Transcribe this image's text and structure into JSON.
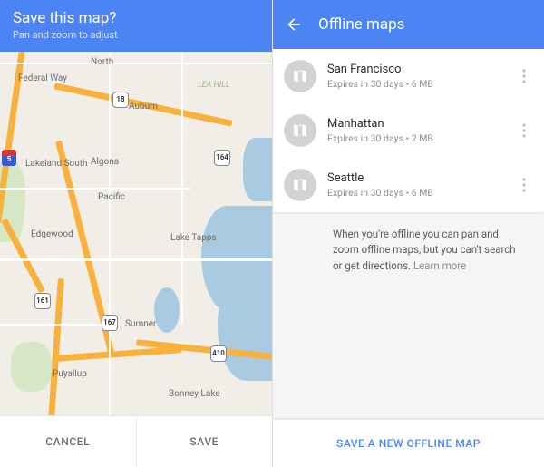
{
  "colors": {
    "primary": "#4c84f4",
    "accent": "#f7b13c",
    "water": "#a9cbe2"
  },
  "left": {
    "title": "Save this map?",
    "subtitle": "Pan and zoom to adjust",
    "cancel": "CANCEL",
    "save": "SAVE",
    "labels": {
      "federal": "Federal Way",
      "north": "North",
      "auburn": "Auburn",
      "leahill": "LEA HILL",
      "lakeland": "Lakeland South",
      "algona": "Algona",
      "pacific": "Pacific",
      "edgewood": "Edgewood",
      "laketapps": "Lake Tapps",
      "sumner": "Sumner",
      "puyallup": "Puyallup",
      "bonney": "Bonney Lake"
    },
    "shields": {
      "i5": "5",
      "r18": "18",
      "r164": "164",
      "r161": "161",
      "r167": "167",
      "r410": "410"
    }
  },
  "right": {
    "title": "Offline maps",
    "items": [
      {
        "name": "San Francisco",
        "meta": "Expires in 30 days  •  6 MB"
      },
      {
        "name": "Manhattan",
        "meta": "Expires in 30 days  •  2 MB"
      },
      {
        "name": "Seattle",
        "meta": "Expires in 30 days  •  6 MB"
      }
    ],
    "info": "When you're offline you can pan and zoom offline maps, but you can't search or get directions. ",
    "learn": "Learn more",
    "save": "SAVE A NEW OFFLINE MAP"
  }
}
